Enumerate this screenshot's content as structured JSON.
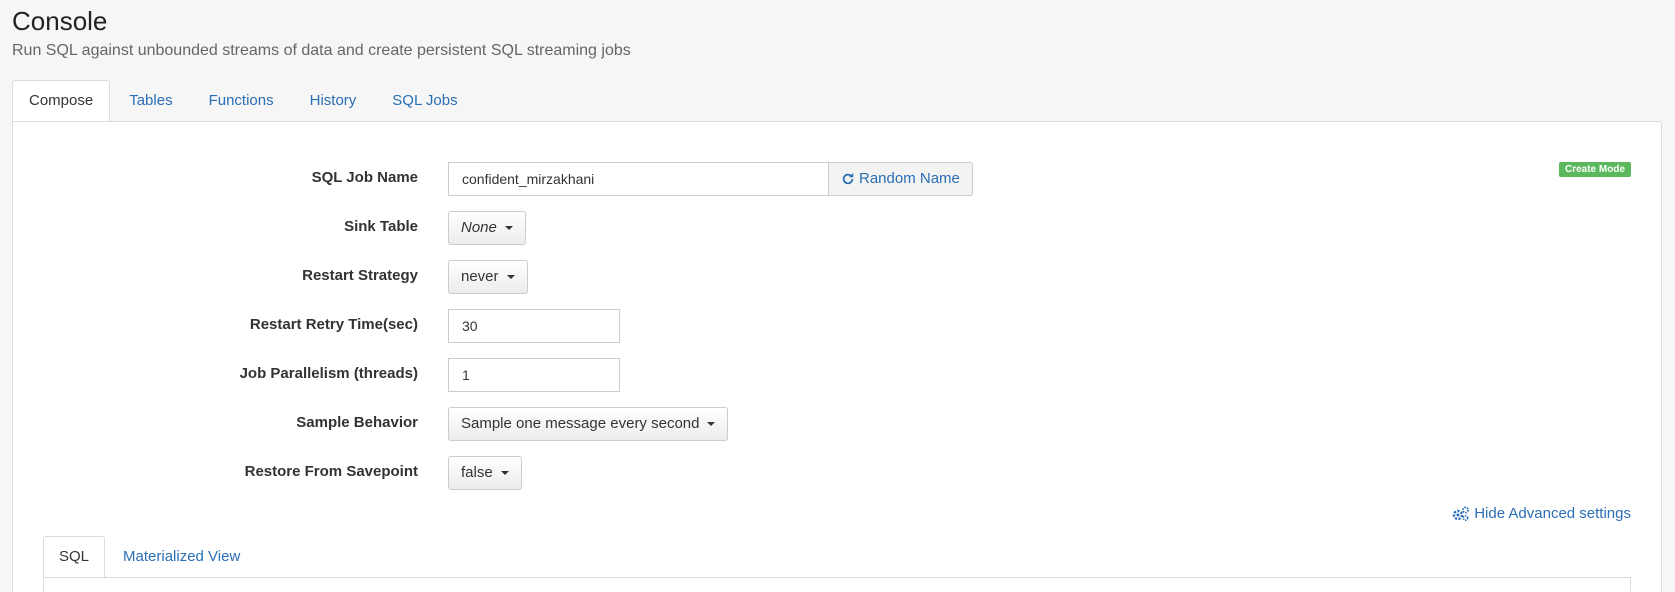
{
  "header": {
    "title": "Console",
    "subtitle": "Run SQL against unbounded streams of data and create persistent SQL streaming jobs"
  },
  "tabs": [
    {
      "label": "Compose",
      "active": true
    },
    {
      "label": "Tables",
      "active": false
    },
    {
      "label": "Functions",
      "active": false
    },
    {
      "label": "History",
      "active": false
    },
    {
      "label": "SQL Jobs",
      "active": false
    }
  ],
  "badge": {
    "label": "Create Mode",
    "color": "#5cb85c"
  },
  "form": {
    "job_name": {
      "label": "SQL Job Name",
      "value": "confident_mirzakhani",
      "random_button": "Random Name",
      "icon": "refresh-icon"
    },
    "sink_table": {
      "label": "Sink Table",
      "value": "None"
    },
    "restart_strategy": {
      "label": "Restart Strategy",
      "value": "never"
    },
    "restart_retry": {
      "label": "Restart Retry Time(sec)",
      "value": "30"
    },
    "parallelism": {
      "label": "Job Parallelism (threads)",
      "value": "1"
    },
    "sample_behavior": {
      "label": "Sample Behavior",
      "value": "Sample one message every second"
    },
    "restore_savepoint": {
      "label": "Restore From Savepoint",
      "value": "false"
    }
  },
  "advanced_link": {
    "label": "Hide Advanced settings",
    "icon": "gears-icon"
  },
  "sub_tabs": [
    {
      "label": "SQL",
      "active": true
    },
    {
      "label": "Materialized View",
      "active": false
    }
  ],
  "colors": {
    "link": "#2a6eb5",
    "success": "#5cb85c"
  }
}
